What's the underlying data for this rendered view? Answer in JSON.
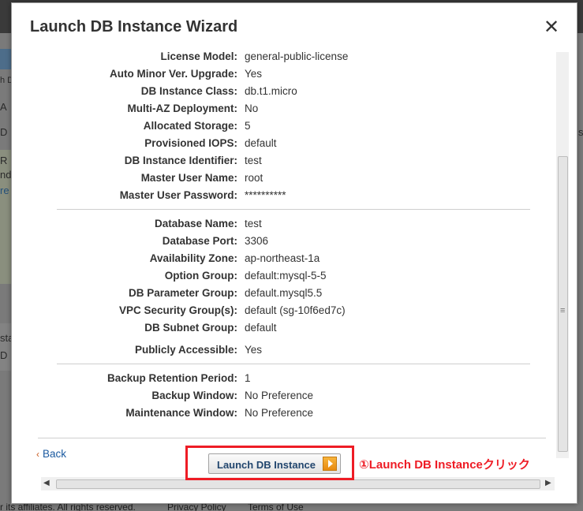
{
  "background": {
    "fragments": [
      "h D",
      "A",
      "D",
      "R",
      "nd",
      "re",
      "sta",
      "D"
    ],
    "right_fragments": [
      "s"
    ],
    "footer": {
      "copyright": "r its affiliates. All rights reserved.",
      "privacy": "Privacy Policy",
      "terms": "Terms of Use"
    }
  },
  "modal": {
    "title": "Launch DB Instance Wizard",
    "close": "✕"
  },
  "details": {
    "group1": [
      {
        "label": "License Model:",
        "value": "general-public-license"
      },
      {
        "label": "Auto Minor Ver. Upgrade:",
        "value": "Yes"
      },
      {
        "label": "DB Instance Class:",
        "value": "db.t1.micro"
      },
      {
        "label": "Multi-AZ Deployment:",
        "value": "No"
      },
      {
        "label": "Allocated Storage:",
        "value": "5"
      },
      {
        "label": "Provisioned IOPS:",
        "value": "default"
      },
      {
        "label": "DB Instance Identifier:",
        "value": "test"
      },
      {
        "label": "Master User Name:",
        "value": "root"
      },
      {
        "label": "Master User Password:",
        "value": "**********"
      }
    ],
    "group2": [
      {
        "label": "Database Name:",
        "value": "test"
      },
      {
        "label": "Database Port:",
        "value": "3306"
      },
      {
        "label": "Availability Zone:",
        "value": "ap-northeast-1a"
      },
      {
        "label": "Option Group:",
        "value": "default:mysql-5-5"
      },
      {
        "label": "DB Parameter Group:",
        "value": "default.mysql5.5"
      },
      {
        "label": "VPC Security Group(s):",
        "value": "default (sg-10f6ed7c)"
      },
      {
        "label": "DB Subnet Group:",
        "value": "default"
      },
      {
        "label": "Publicly Accessible:",
        "value": "Yes"
      }
    ],
    "group3": [
      {
        "label": "Backup Retention Period:",
        "value": "1"
      },
      {
        "label": "Backup Window:",
        "value": "No Preference"
      },
      {
        "label": "Maintenance Window:",
        "value": "No Preference"
      }
    ]
  },
  "footer": {
    "back_chevron": "‹",
    "back": "Back",
    "launch": "Launch DB Instance"
  },
  "annotation": {
    "text": "①Launch DB Instanceクリック",
    "color": "#ee1c25"
  },
  "scrollbar": {
    "grip": "≡",
    "left_arrow": "◀",
    "right_arrow": "▶"
  }
}
